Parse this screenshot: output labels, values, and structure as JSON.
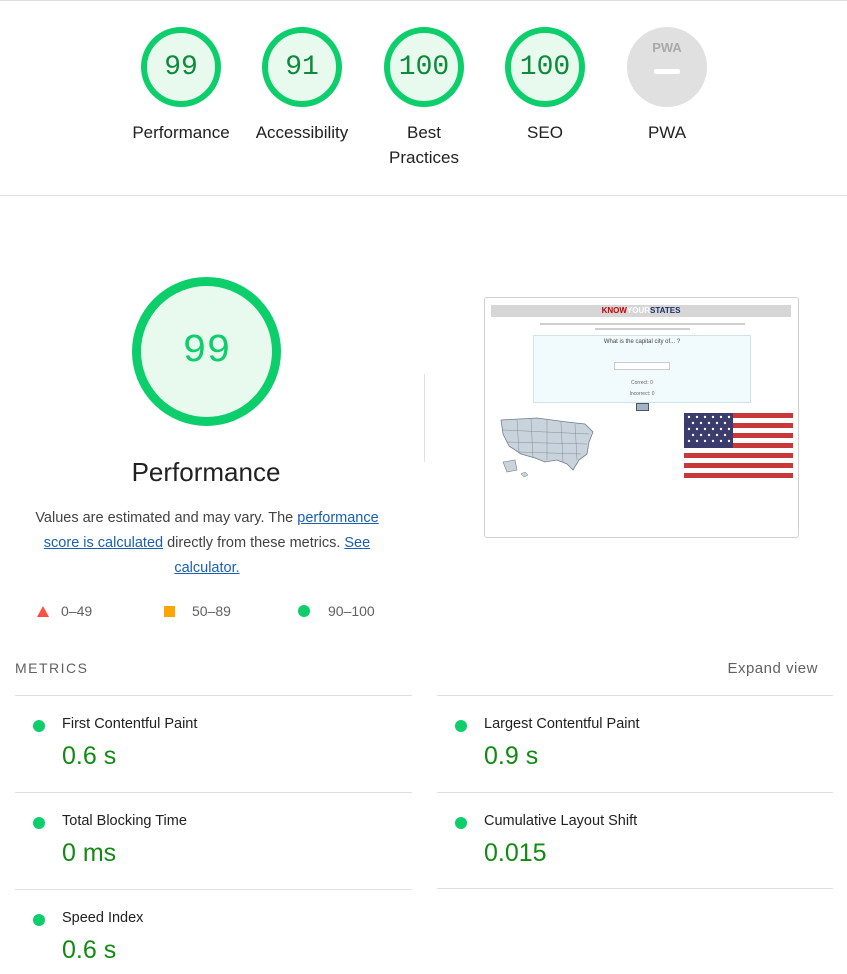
{
  "gauges": [
    {
      "value": "99",
      "label": "Performance"
    },
    {
      "value": "91",
      "label": "Accessibility"
    },
    {
      "value": "100",
      "label": "Best Practices"
    },
    {
      "value": "100",
      "label": "SEO"
    },
    {
      "value": "",
      "label": "PWA",
      "badge": "PWA"
    }
  ],
  "performance": {
    "score": "99",
    "title": "Performance",
    "desc_before": "Values are estimated and may vary. The ",
    "desc_link1": "performance score is calculated",
    "desc_middle": " directly from these metrics. ",
    "desc_link2": "See calculator."
  },
  "legend": [
    {
      "icon": "triangle-icon",
      "range": "0–49",
      "color": "#ff4e42"
    },
    {
      "icon": "square-icon",
      "range": "50–89",
      "color": "#ffa400"
    },
    {
      "icon": "circle-icon",
      "range": "90–100",
      "color": "#0cce6b"
    }
  ],
  "screenshot": {
    "title_know": "KNOW",
    "title_your": "YOUR",
    "title_states": "STATES",
    "question": "What is the capital city of... ?",
    "correct": "Correct: 0",
    "incorrect": "Incorrect: 0"
  },
  "metrics": {
    "heading": "METRICS",
    "expand": "Expand view",
    "items": [
      {
        "name": "First Contentful Paint",
        "value": "0.6 s"
      },
      {
        "name": "Largest Contentful Paint",
        "value": "0.9 s"
      },
      {
        "name": "Total Blocking Time",
        "value": "0 ms"
      },
      {
        "name": "Cumulative Layout Shift",
        "value": "0.015"
      },
      {
        "name": "Speed Index",
        "value": "0.6 s"
      }
    ]
  },
  "colors": {
    "pass": "#0cce6b",
    "pass_text": "#118a11",
    "link": "#1a5fb4"
  }
}
